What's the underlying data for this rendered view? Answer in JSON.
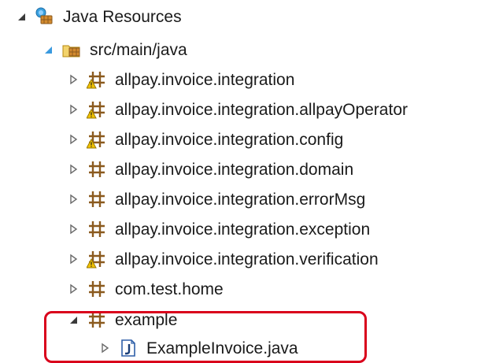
{
  "tree": {
    "root": {
      "label": "Java Resources",
      "icon": "java-resources-icon",
      "expanded": true
    },
    "source_folder": {
      "label": "src/main/java",
      "icon": "source-folder-icon",
      "expanded": true
    },
    "packages": [
      {
        "label": "allpay.invoice.integration",
        "icon": "package-warning-icon",
        "expanded": false
      },
      {
        "label": "allpay.invoice.integration.allpayOperator",
        "icon": "package-warning-icon",
        "expanded": false
      },
      {
        "label": "allpay.invoice.integration.config",
        "icon": "package-warning-icon",
        "expanded": false
      },
      {
        "label": "allpay.invoice.integration.domain",
        "icon": "package-icon",
        "expanded": false
      },
      {
        "label": "allpay.invoice.integration.errorMsg",
        "icon": "package-icon",
        "expanded": false
      },
      {
        "label": "allpay.invoice.integration.exception",
        "icon": "package-icon",
        "expanded": false
      },
      {
        "label": "allpay.invoice.integration.verification",
        "icon": "package-warning-icon",
        "expanded": false
      },
      {
        "label": "com.test.home",
        "icon": "package-icon",
        "expanded": false
      },
      {
        "label": "example",
        "icon": "package-icon",
        "expanded": true
      }
    ],
    "files": [
      {
        "label": "ExampleInvoice.java",
        "icon": "java-file-icon",
        "expanded": false
      }
    ]
  },
  "colors": {
    "highlight": "#d9001b",
    "package_brown": "#8b5a1e",
    "warning_yellow": "#f2c200",
    "java_blue": "#2e5fa8"
  }
}
